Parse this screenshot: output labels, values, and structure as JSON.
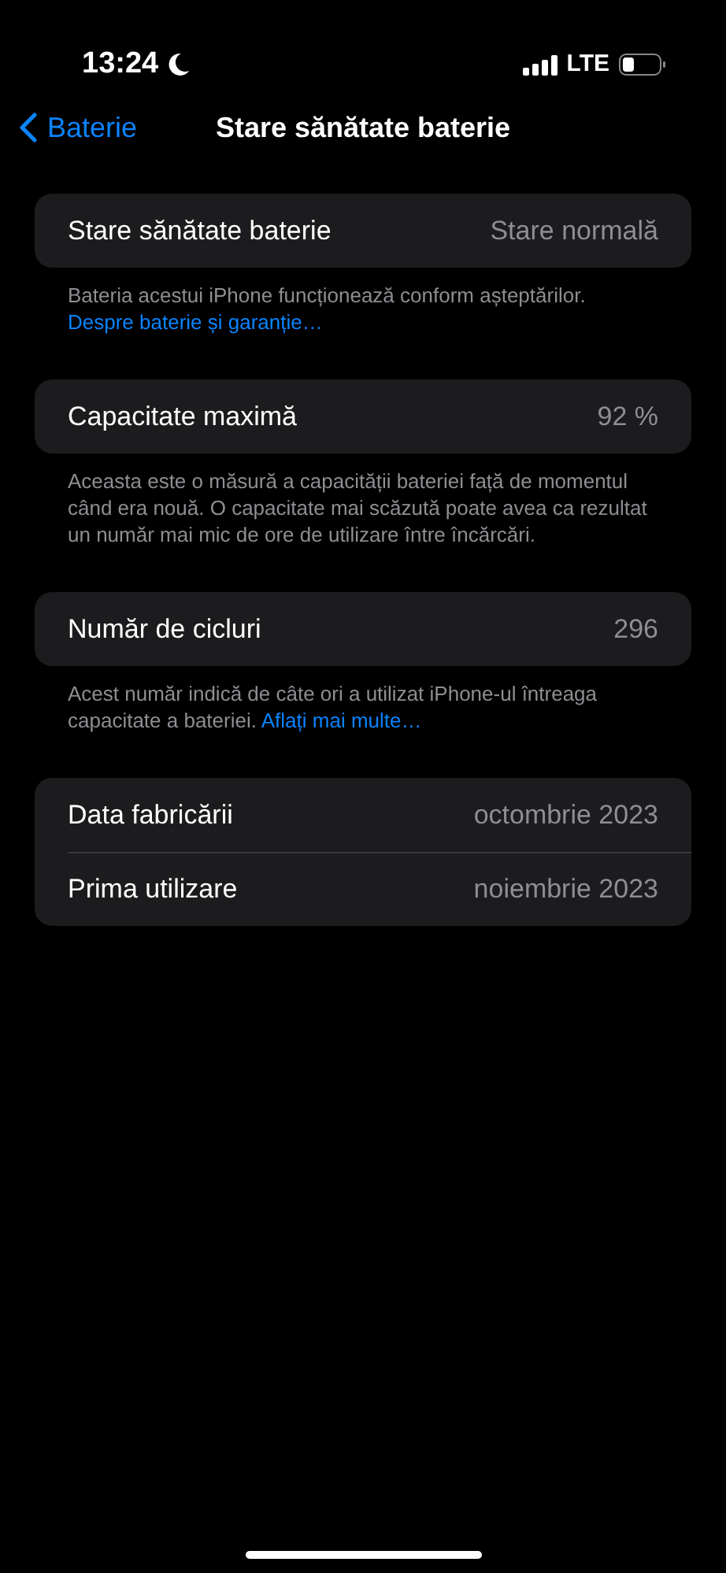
{
  "status_bar": {
    "time": "13:24",
    "network": "LTE"
  },
  "nav": {
    "back": "Baterie",
    "title": "Stare sănătate baterie"
  },
  "sections": [
    {
      "rows": [
        {
          "label": "Stare sănătate baterie",
          "value": "Stare normală"
        }
      ],
      "footer": {
        "text": "Bateria acestui iPhone funcționează conform așteptărilor.",
        "link": "Despre baterie și garanție…"
      }
    },
    {
      "rows": [
        {
          "label": "Capacitate maximă",
          "value": "92 %"
        }
      ],
      "footer": {
        "text": "Aceasta este o măsură a capacității bateriei față de momentul când era nouă. O capacitate mai scăzută poate avea ca rezultat un număr mai mic de ore de utilizare între încărcări."
      }
    },
    {
      "rows": [
        {
          "label": "Număr de cicluri",
          "value": "296"
        }
      ],
      "footer": {
        "text": "Acest număr indică de câte ori a utilizat iPhone-ul întreaga capacitate a bateriei.",
        "link": "Aflați mai multe…"
      }
    },
    {
      "rows": [
        {
          "label": "Data fabricării",
          "value": "octombrie 2023"
        },
        {
          "label": "Prima utilizare",
          "value": "noiembrie 2023"
        }
      ]
    }
  ]
}
